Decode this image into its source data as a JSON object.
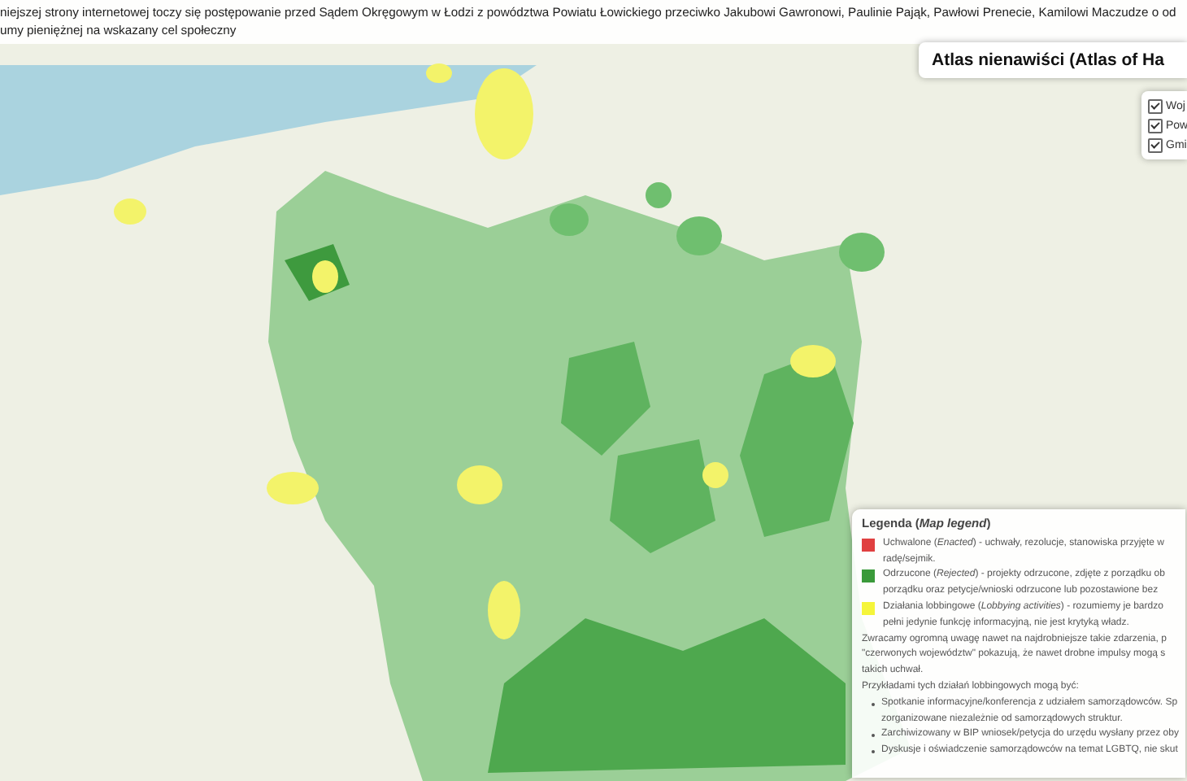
{
  "notice": {
    "lines": [
      "niejszej strony internetowej toczy się postępowanie przed Sądem Okręgowym w Łodzi z powództwa Powiatu Łowickiego przeciwko Jakubowi Gawronowi, Paulinie Pająk, Pawłowi Prenecie, Kamilowi Maczudze o od",
      "umy pieniężnej na wskazany cel społeczny"
    ]
  },
  "title": "Atlas nienawiści (Atlas of Ha",
  "layers": [
    {
      "label": "Woj",
      "checked": true
    },
    {
      "label": "Pow",
      "checked": true
    },
    {
      "label": "Gmi",
      "checked": true
    }
  ],
  "legend": {
    "title": "Legenda (*Map legend*)",
    "items": [
      {
        "color": "#e04040",
        "lines": [
          "Uchwalone (*Enacted*) - uchwały, rezolucje, stanowiska przyjęte w",
          "radę/sejmik."
        ]
      },
      {
        "color": "#3a9a3a",
        "lines": [
          "Odrzucone (*Rejected*) - projekty odrzucone, zdjęte z porządku ob",
          "porządku oraz petycje/wnioski odrzucone lub pozostawione bez"
        ]
      },
      {
        "color": "#f5f53a",
        "lines": [
          "Działania lobbingowe (*Lobbying activities*) - rozumiemy je bardzo",
          "pełni jedynie funkcję informacyjną, nie jest krytyką władz."
        ]
      }
    ],
    "note": [
      "Zwracamy ogromną uwagę nawet na najdrobniejsze takie zdarzenia, p",
      "\"czerwonych województw\" pokazują, że nawet drobne impulsy mogą s",
      "takich uchwał."
    ],
    "examples_heading": "Przykładami tych działań lobbingowych mogą być:",
    "examples": [
      {
        "lines": [
          "Spotkanie informacyjne/konferencja z udziałem samorządowców. Sp",
          "zorganizowane niezależnie od samorządowych struktur."
        ]
      },
      {
        "lines": [
          "Zarchiwizowany w BIP wniosek/petycja do urzędu wysłany przez oby"
        ]
      },
      {
        "lines": [
          "Dyskusje i oświadczenie samorządowców na temat LGBTQ, nie skut"
        ]
      }
    ]
  }
}
